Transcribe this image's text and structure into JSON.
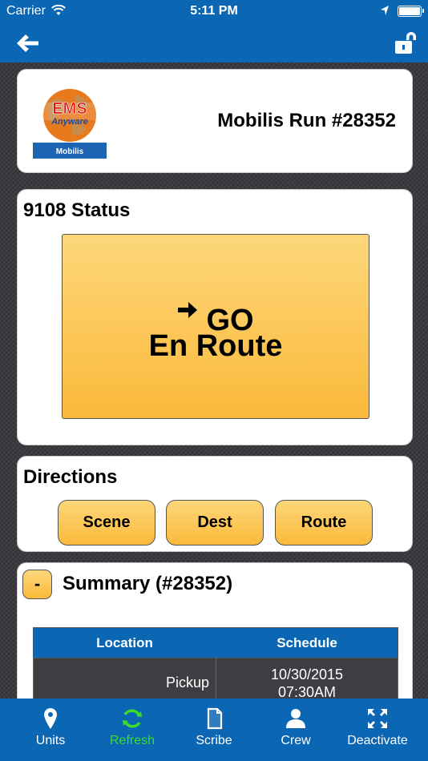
{
  "status_bar": {
    "carrier": "Carrier",
    "time": "5:11 PM",
    "wifi_icon": "wifi-icon",
    "location_icon": "location-arrow-icon",
    "battery_icon": "battery-full-icon"
  },
  "nav": {
    "back_icon": "back-arrow-icon",
    "lock_icon": "unlocked-padlock-icon"
  },
  "header": {
    "logo_text": "EMS Anyware",
    "logo_caption": "Mobilis",
    "run_title": "Mobilis Run #28352"
  },
  "status_section": {
    "title": "9108 Status",
    "action_line1": "GO",
    "action_line2": "En Route",
    "action_icon": "right-arrow-icon"
  },
  "directions": {
    "title": "Directions",
    "buttons": [
      "Scene",
      "Dest",
      "Route"
    ]
  },
  "summary": {
    "toggle_label": "-",
    "title": "Summary (#28352)",
    "columns": [
      "Location",
      "Schedule"
    ],
    "rows": [
      {
        "location": "Pickup",
        "date": "10/30/2015",
        "time": "07:30AM"
      }
    ]
  },
  "tabs": [
    {
      "label": "Units",
      "icon": "map-pin-icon",
      "active": false
    },
    {
      "label": "Refresh",
      "icon": "refresh-icon",
      "active": true
    },
    {
      "label": "Scribe",
      "icon": "document-icon",
      "active": false
    },
    {
      "label": "Crew",
      "icon": "person-icon",
      "active": false
    },
    {
      "label": "Deactivate",
      "icon": "expand-arrows-icon",
      "active": false
    }
  ],
  "colors": {
    "brand_blue": "#0b66b3",
    "button_gold": "#fbb93a",
    "active_tab_green": "#3ddc2c"
  }
}
